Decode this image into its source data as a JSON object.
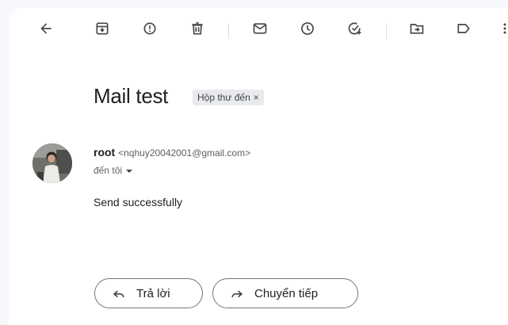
{
  "toolbar": {
    "buttons": [
      {
        "icon": "arrow-back-icon"
      },
      {
        "icon": "archive-icon"
      },
      {
        "icon": "report-spam-icon"
      },
      {
        "icon": "delete-icon"
      },
      {
        "icon": "mark-unread-icon"
      },
      {
        "icon": "snooze-icon"
      },
      {
        "icon": "add-task-icon"
      },
      {
        "icon": "move-to-icon"
      },
      {
        "icon": "label-icon"
      },
      {
        "icon": "more-vert-icon"
      }
    ]
  },
  "message": {
    "subject": "Mail test",
    "label_chip": "Hộp thư đến",
    "label_chip_close": "×",
    "sender_name": "root",
    "sender_email": "<nqhuy20042001@gmail.com>",
    "recipient": "đến tôi",
    "body": "Send successfully"
  },
  "actions": {
    "reply_label": "Trả lời",
    "forward_label": "Chuyển tiếp"
  },
  "colors": {
    "background": "#f6f8fc",
    "panel": "#ffffff",
    "text_primary": "#1f1f1f",
    "icon": "#444746",
    "chip_bg": "#e8eaed"
  }
}
